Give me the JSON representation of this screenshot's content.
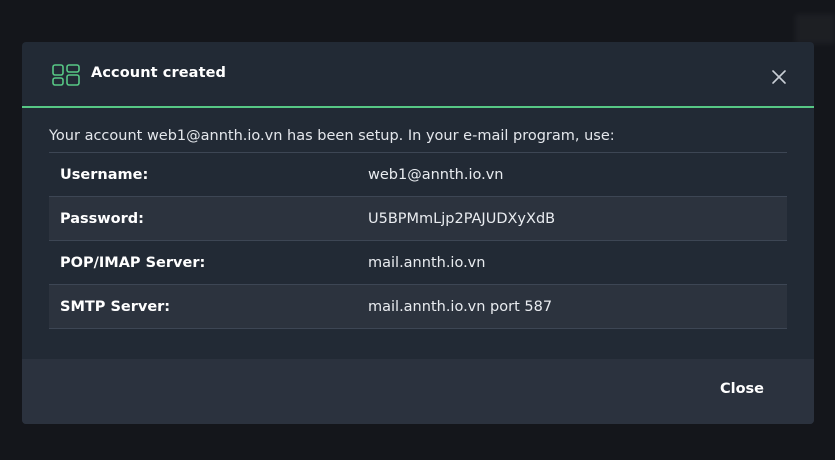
{
  "modal": {
    "title": "Account created",
    "intro": "Your account web1@annth.io.vn has been setup. In your e-mail program, use:",
    "rows": [
      {
        "label": "Username:",
        "value": "web1@annth.io.vn"
      },
      {
        "label": "Password:",
        "value": "U5BPMmLjp2PAJUDXyXdB"
      },
      {
        "label": "POP/IMAP Server:",
        "value": "mail.annth.io.vn"
      },
      {
        "label": "SMTP Server:",
        "value": "mail.annth.io.vn port 587"
      }
    ],
    "close_label": "Close"
  },
  "icons": {
    "header": "layout-grid-icon",
    "close": "close-icon"
  },
  "colors": {
    "accent": "#57c785",
    "modal_bg": "#222a35",
    "footer_bg": "#2b323e",
    "row_alt_bg": "#2c333e",
    "backdrop": "#14161b"
  }
}
